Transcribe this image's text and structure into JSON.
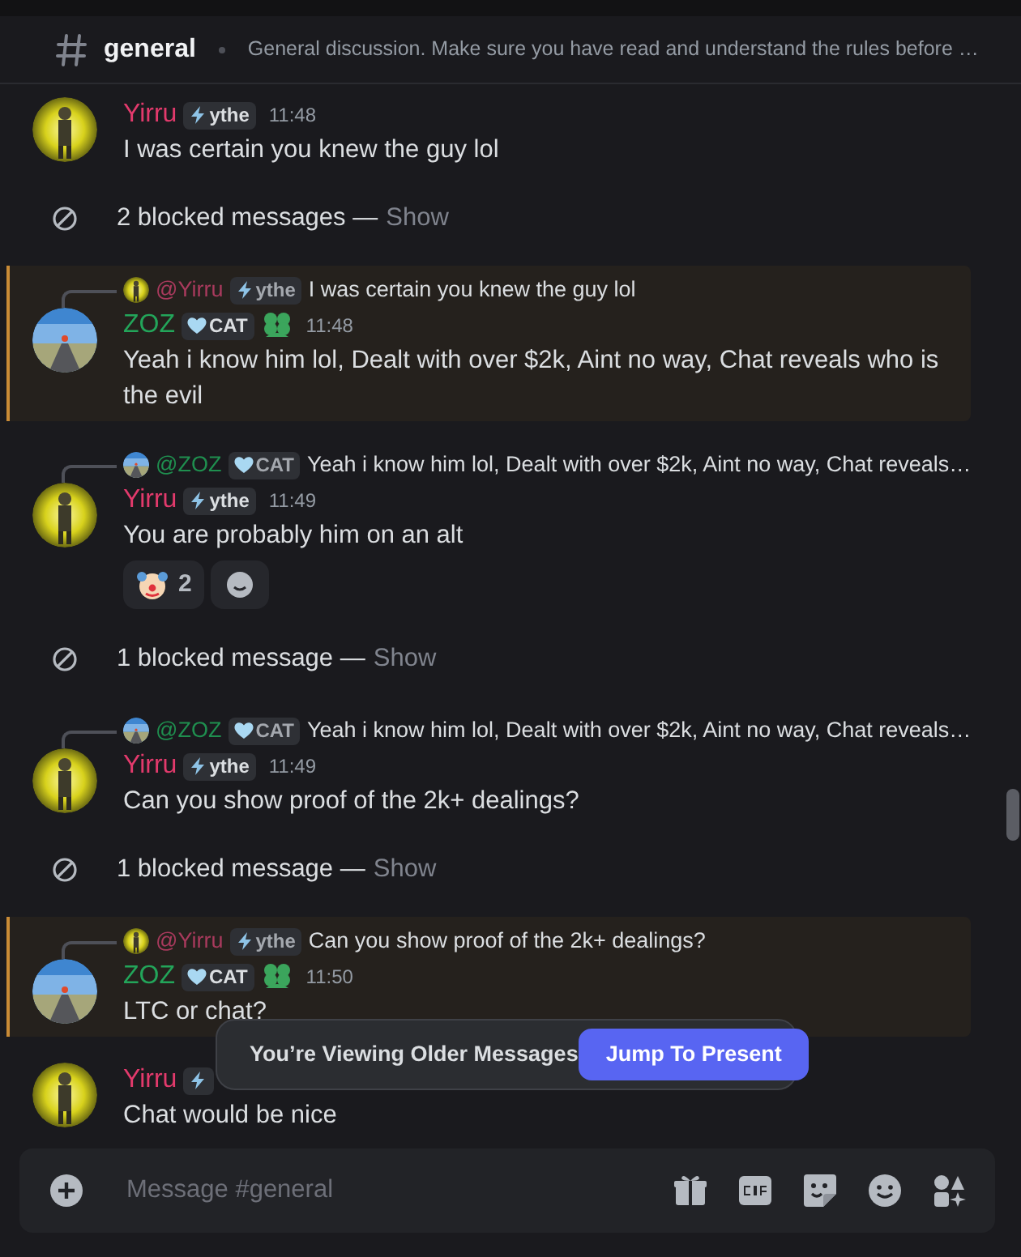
{
  "header": {
    "channel": "general",
    "topic": "General discussion. Make sure you have read and understand the rules before …"
  },
  "messages": [
    {
      "kind": "message",
      "highlighted": false,
      "author": "Yirru",
      "color": "#e23a6c",
      "tag": {
        "kind": "bolt",
        "label": "ythe"
      },
      "role_icon": false,
      "time": "11:48",
      "text": "I was certain you knew the guy lol"
    },
    {
      "kind": "blocked",
      "label": "2 blocked messages —",
      "action": "Show"
    },
    {
      "kind": "message",
      "highlighted": true,
      "reply": {
        "author": "@Yirru",
        "color": "#a93a5d",
        "tag": {
          "kind": "bolt",
          "label": "ythe"
        },
        "text": "I was certain you knew the guy lol"
      },
      "author": "ZOZ",
      "color": "#23a55a",
      "tag": {
        "kind": "heart",
        "label": "CAT"
      },
      "role_icon": true,
      "time": "11:48",
      "text": "Yeah i know him lol, Dealt with over $2k, Aint no way, Chat reveals who is the evil"
    },
    {
      "kind": "message",
      "highlighted": false,
      "reply": {
        "author": "@ZOZ",
        "color": "#1f8f4f",
        "tag": {
          "kind": "heart",
          "label": "CAT"
        },
        "text": "Yeah i know him lol, Dealt with over $2k, Aint no way, Chat reveals…"
      },
      "author": "Yirru",
      "color": "#e23a6c",
      "tag": {
        "kind": "bolt",
        "label": "ythe"
      },
      "role_icon": false,
      "time": "11:49",
      "text": "You are probably him on an alt",
      "reactions": [
        {
          "kind": "clown",
          "count": "2"
        }
      ]
    },
    {
      "kind": "blocked",
      "label": "1 blocked message —",
      "action": "Show"
    },
    {
      "kind": "message",
      "highlighted": false,
      "reply": {
        "author": "@ZOZ",
        "color": "#1f8f4f",
        "tag": {
          "kind": "heart",
          "label": "CAT"
        },
        "text": "Yeah i know him lol, Dealt with over $2k, Aint no way, Chat reveals…"
      },
      "author": "Yirru",
      "color": "#e23a6c",
      "tag": {
        "kind": "bolt",
        "label": "ythe"
      },
      "role_icon": false,
      "time": "11:49",
      "text": "Can you show proof of the 2k+ dealings?"
    },
    {
      "kind": "blocked",
      "label": "1 blocked message —",
      "action": "Show"
    },
    {
      "kind": "message",
      "highlighted": true,
      "reply": {
        "author": "@Yirru",
        "color": "#a93a5d",
        "tag": {
          "kind": "bolt",
          "label": "ythe"
        },
        "text": "Can you show proof of the 2k+ dealings?"
      },
      "author": "ZOZ",
      "color": "#23a55a",
      "tag": {
        "kind": "heart",
        "label": "CAT"
      },
      "role_icon": true,
      "time": "11:50",
      "text": "LTC or chat?"
    },
    {
      "kind": "message",
      "highlighted": false,
      "author": "Yirru",
      "color": "#e23a6c",
      "tag": {
        "kind": "bolt"
      },
      "role_icon": false,
      "text": "Chat would be nice"
    }
  ],
  "older_banner": {
    "text": "You’re Viewing Older Messages",
    "button": "Jump To Present"
  },
  "composer": {
    "placeholder": "Message #general"
  }
}
